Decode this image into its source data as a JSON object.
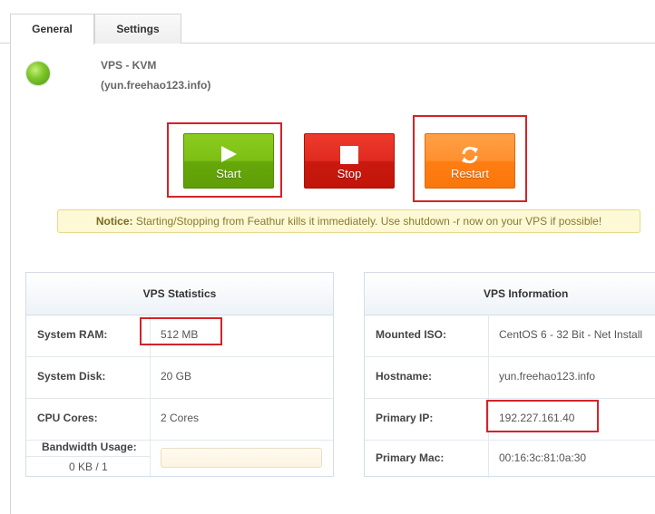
{
  "tabs": [
    {
      "label": "General",
      "active": true
    },
    {
      "label": "Settings",
      "active": false
    }
  ],
  "vps": {
    "title": "VPS - KVM",
    "hostname": "(yun.freehao123.info)",
    "status_color": "#7fc72c"
  },
  "buttons": {
    "start": "Start",
    "stop": "Stop",
    "restart": "Restart"
  },
  "notice": {
    "label": "Notice:",
    "text": " Starting/Stopping from Feathur kills it immediately. Use shutdown -r now on your VPS if possible!"
  },
  "stats": {
    "title": "VPS Statistics",
    "rows": [
      {
        "label": "System RAM:",
        "value": "512 MB"
      },
      {
        "label": "System Disk:",
        "value": "20 GB"
      },
      {
        "label": "CPU Cores:",
        "value": "2 Cores"
      }
    ],
    "bandwidth_label": "Bandwidth Usage:",
    "bandwidth_value": "0 KB / 1"
  },
  "info": {
    "title": "VPS Information",
    "rows": [
      {
        "label": "Mounted ISO:",
        "value": "CentOS 6 - 32 Bit - Net Install"
      },
      {
        "label": "Hostname:",
        "value": "yun.freehao123.info"
      },
      {
        "label": "Primary IP:",
        "value": "192.227.161.40"
      },
      {
        "label": "Primary Mac:",
        "value": "00:16:3c:81:0a:30"
      }
    ]
  },
  "colors": {
    "start": "#7cbf14",
    "stop": "#e02a1f",
    "restart": "#ff8f2e",
    "highlight": "#d2232a"
  }
}
